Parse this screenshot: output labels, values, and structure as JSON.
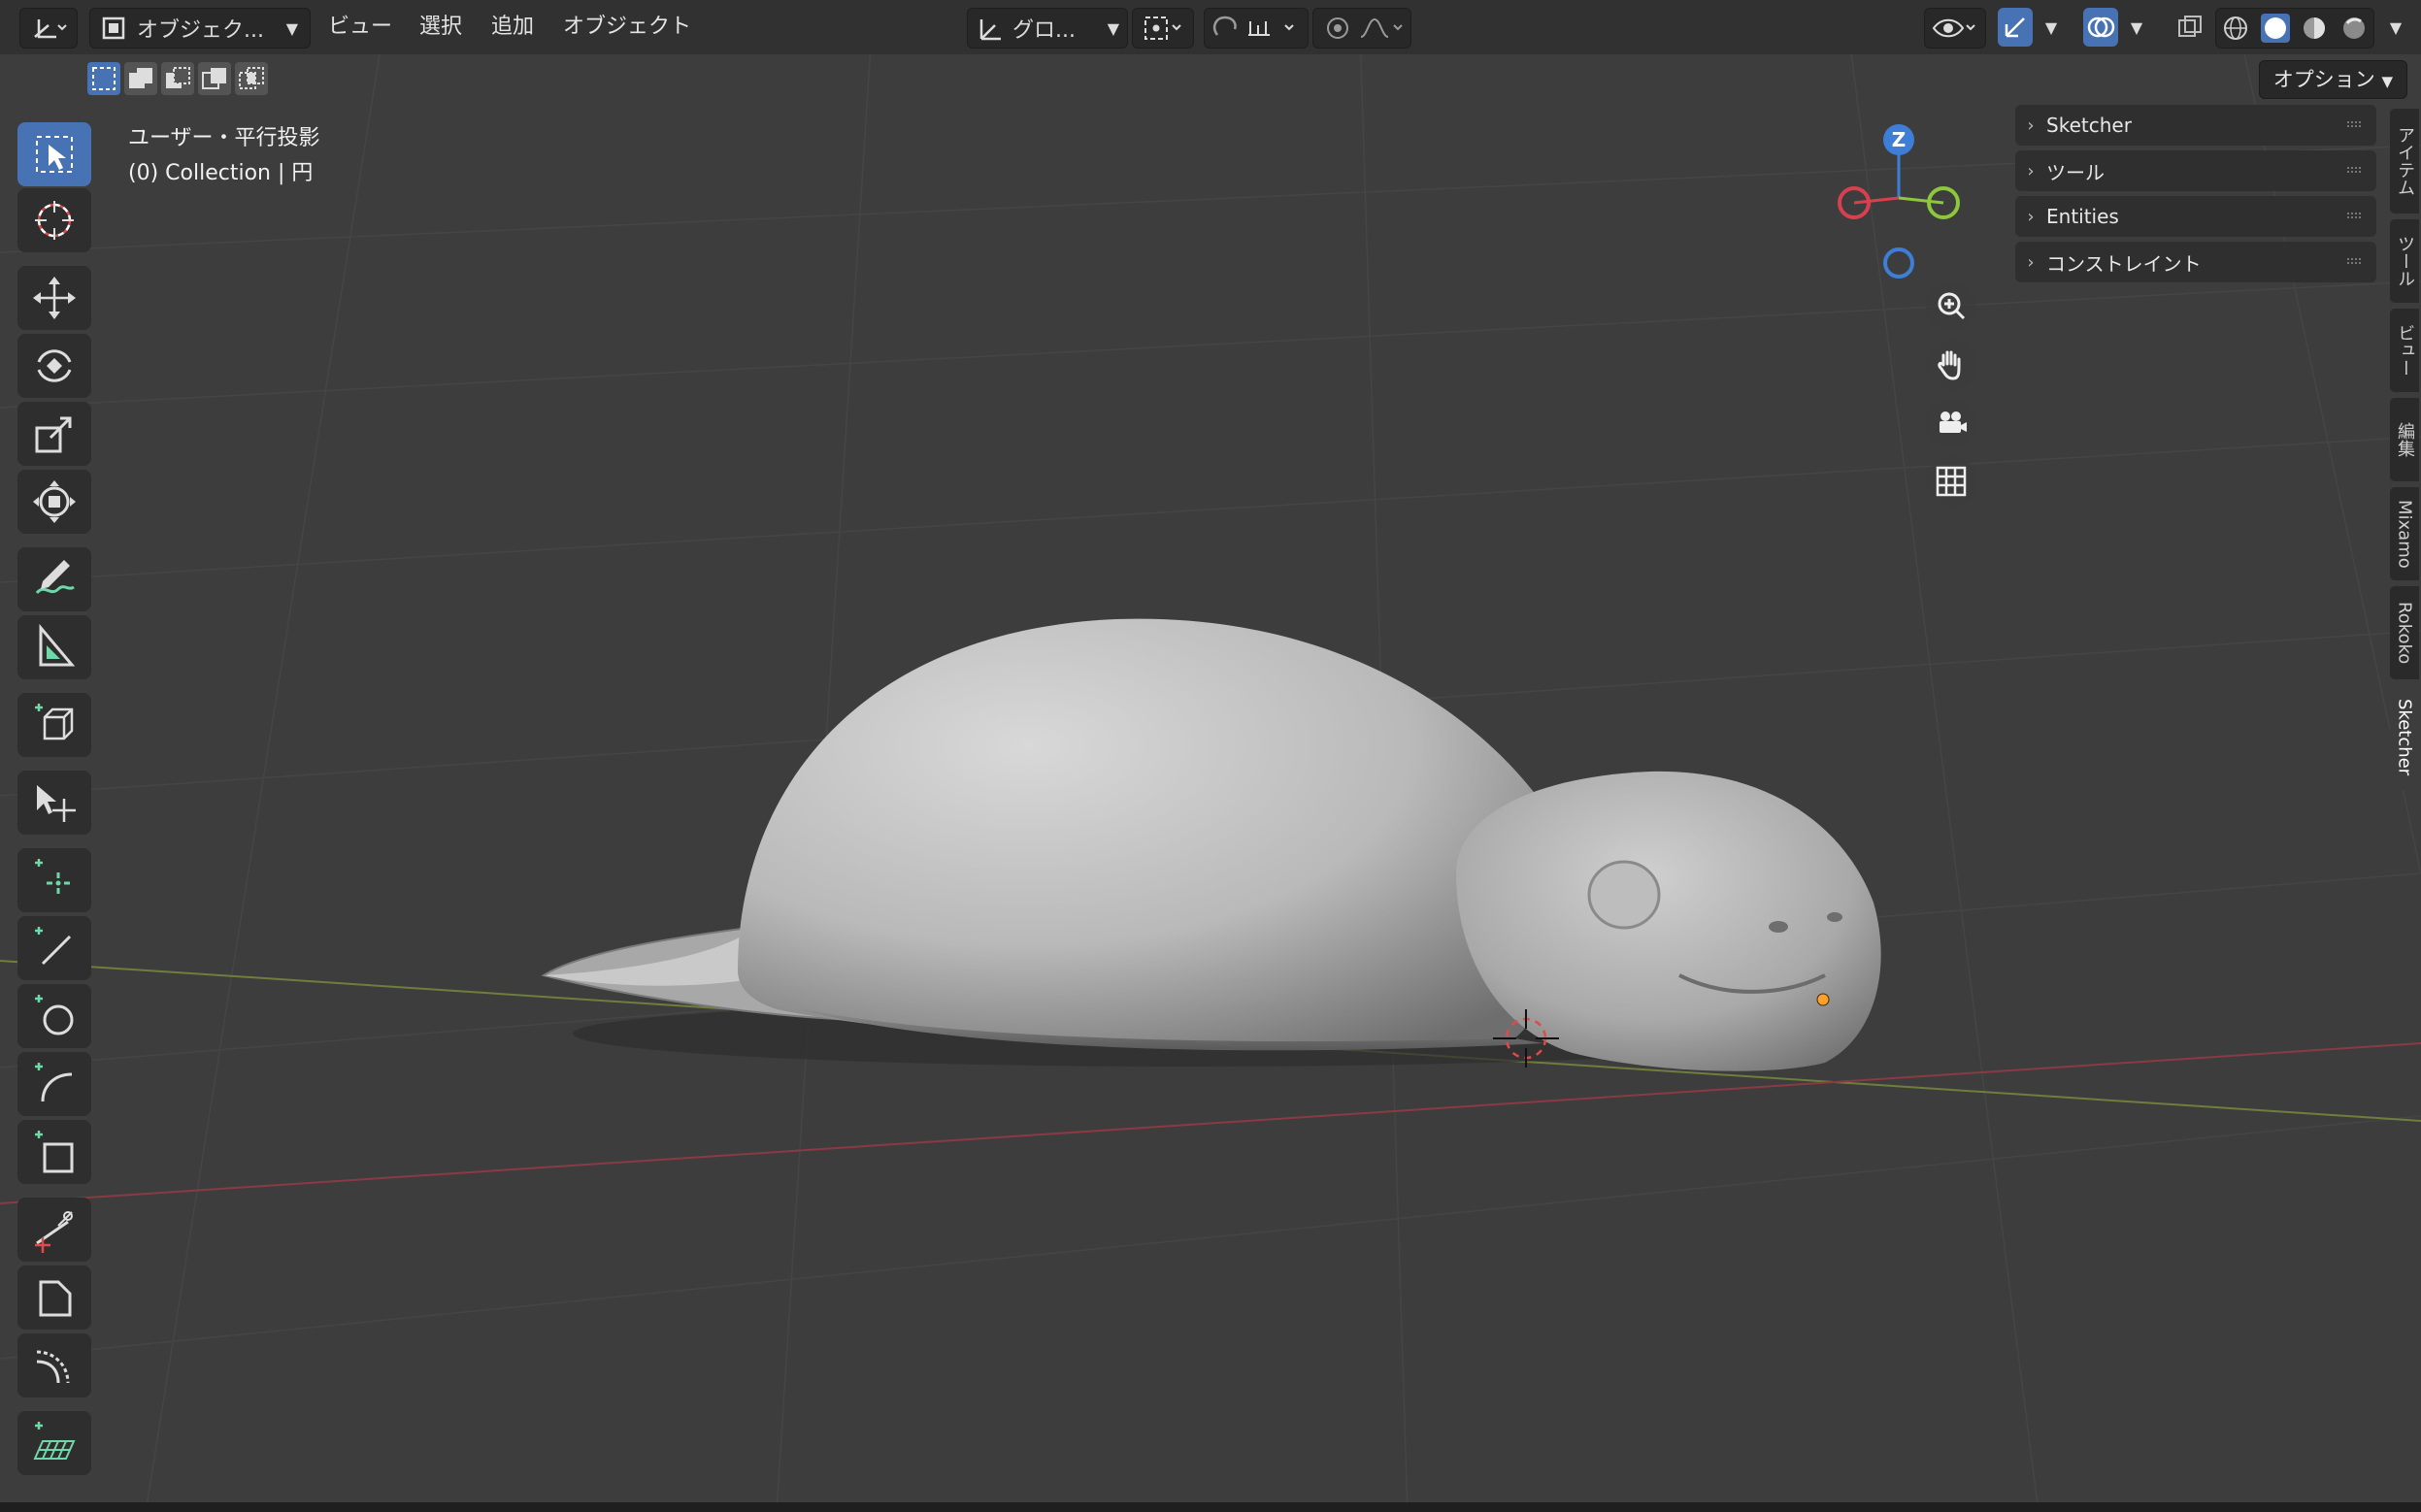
{
  "header": {
    "mode_label": "オブジェク...",
    "menus": [
      "ビュー",
      "選択",
      "追加",
      "オブジェクト"
    ],
    "orientation_label": "グロ...",
    "options_label": "オプション"
  },
  "viewport": {
    "view_name": "ユーザー・平行投影",
    "collection_info": "(0) Collection | 円"
  },
  "gizmo": {
    "z_label": "Z"
  },
  "sidebar": {
    "panels": [
      "Sketcher",
      "ツール",
      "Entities",
      "コンストレイント"
    ],
    "tabs": [
      "アイテム",
      "ツール",
      "ビュー",
      "編集",
      "Mixamo",
      "Rokoko",
      "Sketcher"
    ],
    "active_tab": "Sketcher"
  },
  "colors": {
    "accent": "#4772b3",
    "x_axis": "#d9404f",
    "y_axis": "#8cc83a",
    "z_axis": "#3e7ed6",
    "add_tool": "#6fd8a8"
  },
  "toolbar_icons": [
    "select-box-icon",
    "cursor-icon",
    "move-icon",
    "rotate-icon",
    "scale-icon",
    "transform-icon",
    "annotate-icon",
    "measure-icon",
    "add-cube-icon",
    "select-transform-icon",
    "add-point-icon",
    "add-line-icon",
    "add-circle-icon",
    "add-arc-icon",
    "add-rectangle-icon",
    "trim-icon",
    "bevel-icon",
    "offset-icon",
    "add-workplane-icon"
  ]
}
